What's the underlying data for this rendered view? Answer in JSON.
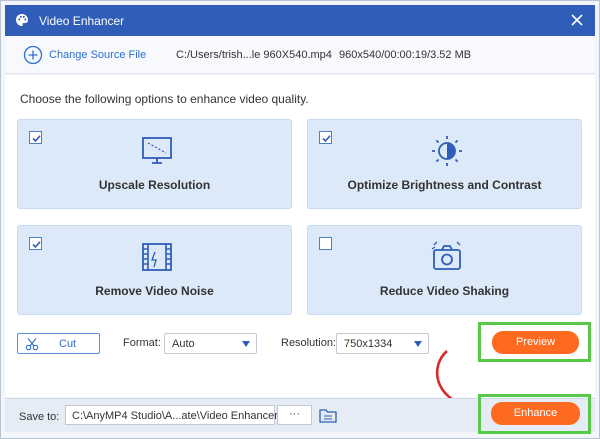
{
  "window": {
    "title": "Video Enhancer"
  },
  "source": {
    "change_label": "Change Source File",
    "path": "C:/Users/trish...le 960X540.mp4",
    "meta": "960x540/00:00:19/3.52 MB"
  },
  "instruction": "Choose the following options to enhance video quality.",
  "options": [
    {
      "label": "Upscale Resolution",
      "checked": true,
      "icon": "monitor-icon"
    },
    {
      "label": "Optimize Brightness and Contrast",
      "checked": true,
      "icon": "brightness-icon"
    },
    {
      "label": "Remove Video Noise",
      "checked": true,
      "icon": "film-icon"
    },
    {
      "label": "Reduce Video Shaking",
      "checked": false,
      "icon": "camera-shake-icon"
    }
  ],
  "controls": {
    "cut_label": "Cut",
    "format_label": "Format:",
    "format_value": "Auto",
    "resolution_label": "Resolution:",
    "resolution_value": "750x1334",
    "preview_label": "Preview"
  },
  "save": {
    "label": "Save to:",
    "path": "C:\\AnyMP4 Studio\\A...ate\\Video Enhancer",
    "browse_label": "···",
    "enhance_label": "Enhance"
  },
  "colors": {
    "titlebar": "#2f5db8",
    "accent_blue": "#2e6fcf",
    "option_bg": "#dce9f8",
    "button_orange": "#ff6a21",
    "highlight_green": "#58c946",
    "annotation_red": "#d62b2b"
  }
}
